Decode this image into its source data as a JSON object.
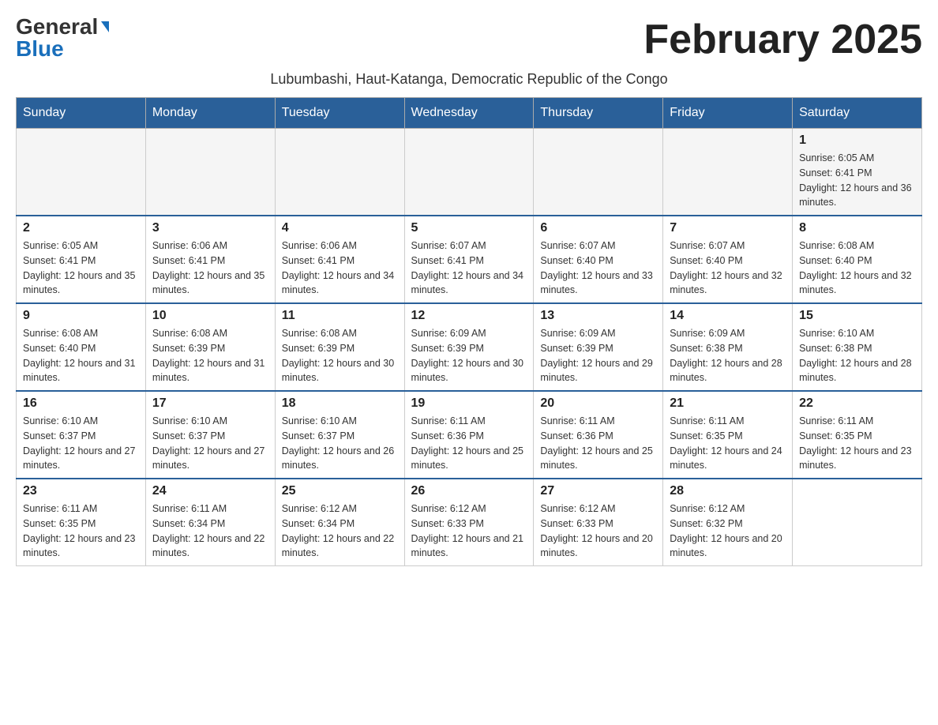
{
  "header": {
    "logo_general": "General",
    "logo_blue": "Blue",
    "month_title": "February 2025",
    "subtitle": "Lubumbashi, Haut-Katanga, Democratic Republic of the Congo"
  },
  "days_of_week": [
    "Sunday",
    "Monday",
    "Tuesday",
    "Wednesday",
    "Thursday",
    "Friday",
    "Saturday"
  ],
  "weeks": [
    [
      {
        "day": "",
        "info": ""
      },
      {
        "day": "",
        "info": ""
      },
      {
        "day": "",
        "info": ""
      },
      {
        "day": "",
        "info": ""
      },
      {
        "day": "",
        "info": ""
      },
      {
        "day": "",
        "info": ""
      },
      {
        "day": "1",
        "info": "Sunrise: 6:05 AM\nSunset: 6:41 PM\nDaylight: 12 hours and 36 minutes."
      }
    ],
    [
      {
        "day": "2",
        "info": "Sunrise: 6:05 AM\nSunset: 6:41 PM\nDaylight: 12 hours and 35 minutes."
      },
      {
        "day": "3",
        "info": "Sunrise: 6:06 AM\nSunset: 6:41 PM\nDaylight: 12 hours and 35 minutes."
      },
      {
        "day": "4",
        "info": "Sunrise: 6:06 AM\nSunset: 6:41 PM\nDaylight: 12 hours and 34 minutes."
      },
      {
        "day": "5",
        "info": "Sunrise: 6:07 AM\nSunset: 6:41 PM\nDaylight: 12 hours and 34 minutes."
      },
      {
        "day": "6",
        "info": "Sunrise: 6:07 AM\nSunset: 6:40 PM\nDaylight: 12 hours and 33 minutes."
      },
      {
        "day": "7",
        "info": "Sunrise: 6:07 AM\nSunset: 6:40 PM\nDaylight: 12 hours and 32 minutes."
      },
      {
        "day": "8",
        "info": "Sunrise: 6:08 AM\nSunset: 6:40 PM\nDaylight: 12 hours and 32 minutes."
      }
    ],
    [
      {
        "day": "9",
        "info": "Sunrise: 6:08 AM\nSunset: 6:40 PM\nDaylight: 12 hours and 31 minutes."
      },
      {
        "day": "10",
        "info": "Sunrise: 6:08 AM\nSunset: 6:39 PM\nDaylight: 12 hours and 31 minutes."
      },
      {
        "day": "11",
        "info": "Sunrise: 6:08 AM\nSunset: 6:39 PM\nDaylight: 12 hours and 30 minutes."
      },
      {
        "day": "12",
        "info": "Sunrise: 6:09 AM\nSunset: 6:39 PM\nDaylight: 12 hours and 30 minutes."
      },
      {
        "day": "13",
        "info": "Sunrise: 6:09 AM\nSunset: 6:39 PM\nDaylight: 12 hours and 29 minutes."
      },
      {
        "day": "14",
        "info": "Sunrise: 6:09 AM\nSunset: 6:38 PM\nDaylight: 12 hours and 28 minutes."
      },
      {
        "day": "15",
        "info": "Sunrise: 6:10 AM\nSunset: 6:38 PM\nDaylight: 12 hours and 28 minutes."
      }
    ],
    [
      {
        "day": "16",
        "info": "Sunrise: 6:10 AM\nSunset: 6:37 PM\nDaylight: 12 hours and 27 minutes."
      },
      {
        "day": "17",
        "info": "Sunrise: 6:10 AM\nSunset: 6:37 PM\nDaylight: 12 hours and 27 minutes."
      },
      {
        "day": "18",
        "info": "Sunrise: 6:10 AM\nSunset: 6:37 PM\nDaylight: 12 hours and 26 minutes."
      },
      {
        "day": "19",
        "info": "Sunrise: 6:11 AM\nSunset: 6:36 PM\nDaylight: 12 hours and 25 minutes."
      },
      {
        "day": "20",
        "info": "Sunrise: 6:11 AM\nSunset: 6:36 PM\nDaylight: 12 hours and 25 minutes."
      },
      {
        "day": "21",
        "info": "Sunrise: 6:11 AM\nSunset: 6:35 PM\nDaylight: 12 hours and 24 minutes."
      },
      {
        "day": "22",
        "info": "Sunrise: 6:11 AM\nSunset: 6:35 PM\nDaylight: 12 hours and 23 minutes."
      }
    ],
    [
      {
        "day": "23",
        "info": "Sunrise: 6:11 AM\nSunset: 6:35 PM\nDaylight: 12 hours and 23 minutes."
      },
      {
        "day": "24",
        "info": "Sunrise: 6:11 AM\nSunset: 6:34 PM\nDaylight: 12 hours and 22 minutes."
      },
      {
        "day": "25",
        "info": "Sunrise: 6:12 AM\nSunset: 6:34 PM\nDaylight: 12 hours and 22 minutes."
      },
      {
        "day": "26",
        "info": "Sunrise: 6:12 AM\nSunset: 6:33 PM\nDaylight: 12 hours and 21 minutes."
      },
      {
        "day": "27",
        "info": "Sunrise: 6:12 AM\nSunset: 6:33 PM\nDaylight: 12 hours and 20 minutes."
      },
      {
        "day": "28",
        "info": "Sunrise: 6:12 AM\nSunset: 6:32 PM\nDaylight: 12 hours and 20 minutes."
      },
      {
        "day": "",
        "info": ""
      }
    ]
  ]
}
